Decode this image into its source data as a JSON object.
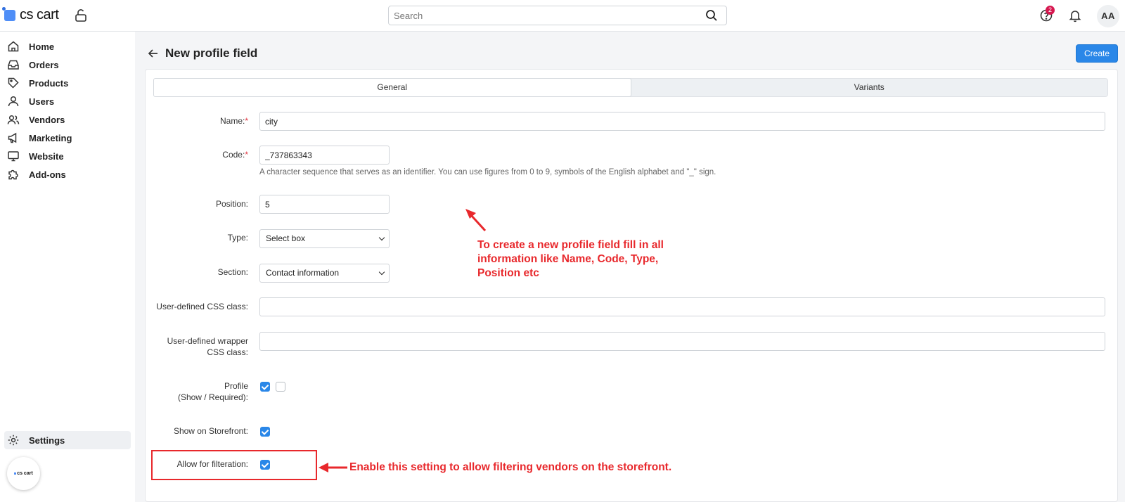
{
  "app": {
    "logo_text": "cs cart"
  },
  "search": {
    "placeholder": "Search"
  },
  "header": {
    "notifications_count": "2",
    "avatar_initials": "AA"
  },
  "sidebar": {
    "items": [
      {
        "label": "Home",
        "icon": "home-icon"
      },
      {
        "label": "Orders",
        "icon": "inbox-icon"
      },
      {
        "label": "Products",
        "icon": "tag-icon"
      },
      {
        "label": "Users",
        "icon": "user-icon"
      },
      {
        "label": "Vendors",
        "icon": "users-icon"
      },
      {
        "label": "Marketing",
        "icon": "megaphone-icon"
      },
      {
        "label": "Website",
        "icon": "monitor-icon"
      },
      {
        "label": "Add-ons",
        "icon": "puzzle-icon"
      }
    ],
    "settings": {
      "label": "Settings",
      "icon": "gear-icon"
    },
    "bottom_logo_text": "cs cart"
  },
  "page": {
    "title": "New profile field",
    "create_label": "Create",
    "tabs": [
      {
        "label": "General",
        "active": true
      },
      {
        "label": "Variants",
        "active": false
      }
    ]
  },
  "form": {
    "name": {
      "label": "Name:",
      "value": "city"
    },
    "code": {
      "label": "Code:",
      "value": "_737863343",
      "hint": "A character sequence that serves as an identifier. You can use figures from 0 to 9, symbols of the English alphabet and \"_\" sign."
    },
    "position": {
      "label": "Position:",
      "value": "5"
    },
    "type": {
      "label": "Type:",
      "value": "Select box"
    },
    "section": {
      "label": "Section:",
      "value": "Contact information"
    },
    "css_class": {
      "label": "User-defined CSS class:",
      "value": ""
    },
    "wrapper_css": {
      "label_line1": "User-defined wrapper",
      "label_line2": "CSS class:",
      "value": ""
    },
    "profile": {
      "label_line1": "Profile",
      "label_line2": "(Show / Required):",
      "show": true,
      "required": false
    },
    "storefront": {
      "label": "Show on Storefront:",
      "checked": true
    },
    "filteration": {
      "label": "Allow for filteration:",
      "checked": true
    }
  },
  "annotations": {
    "note1_line1": "To create a new profile field fill in all",
    "note1_line2": "information like Name, Code, Type,",
    "note1_line3": "Position etc",
    "note2": "Enable this setting to allow filtering vendors on the storefront."
  },
  "colors": {
    "accent": "#2a87e8",
    "annotation": "#e8282c",
    "badge": "#d6174f"
  }
}
